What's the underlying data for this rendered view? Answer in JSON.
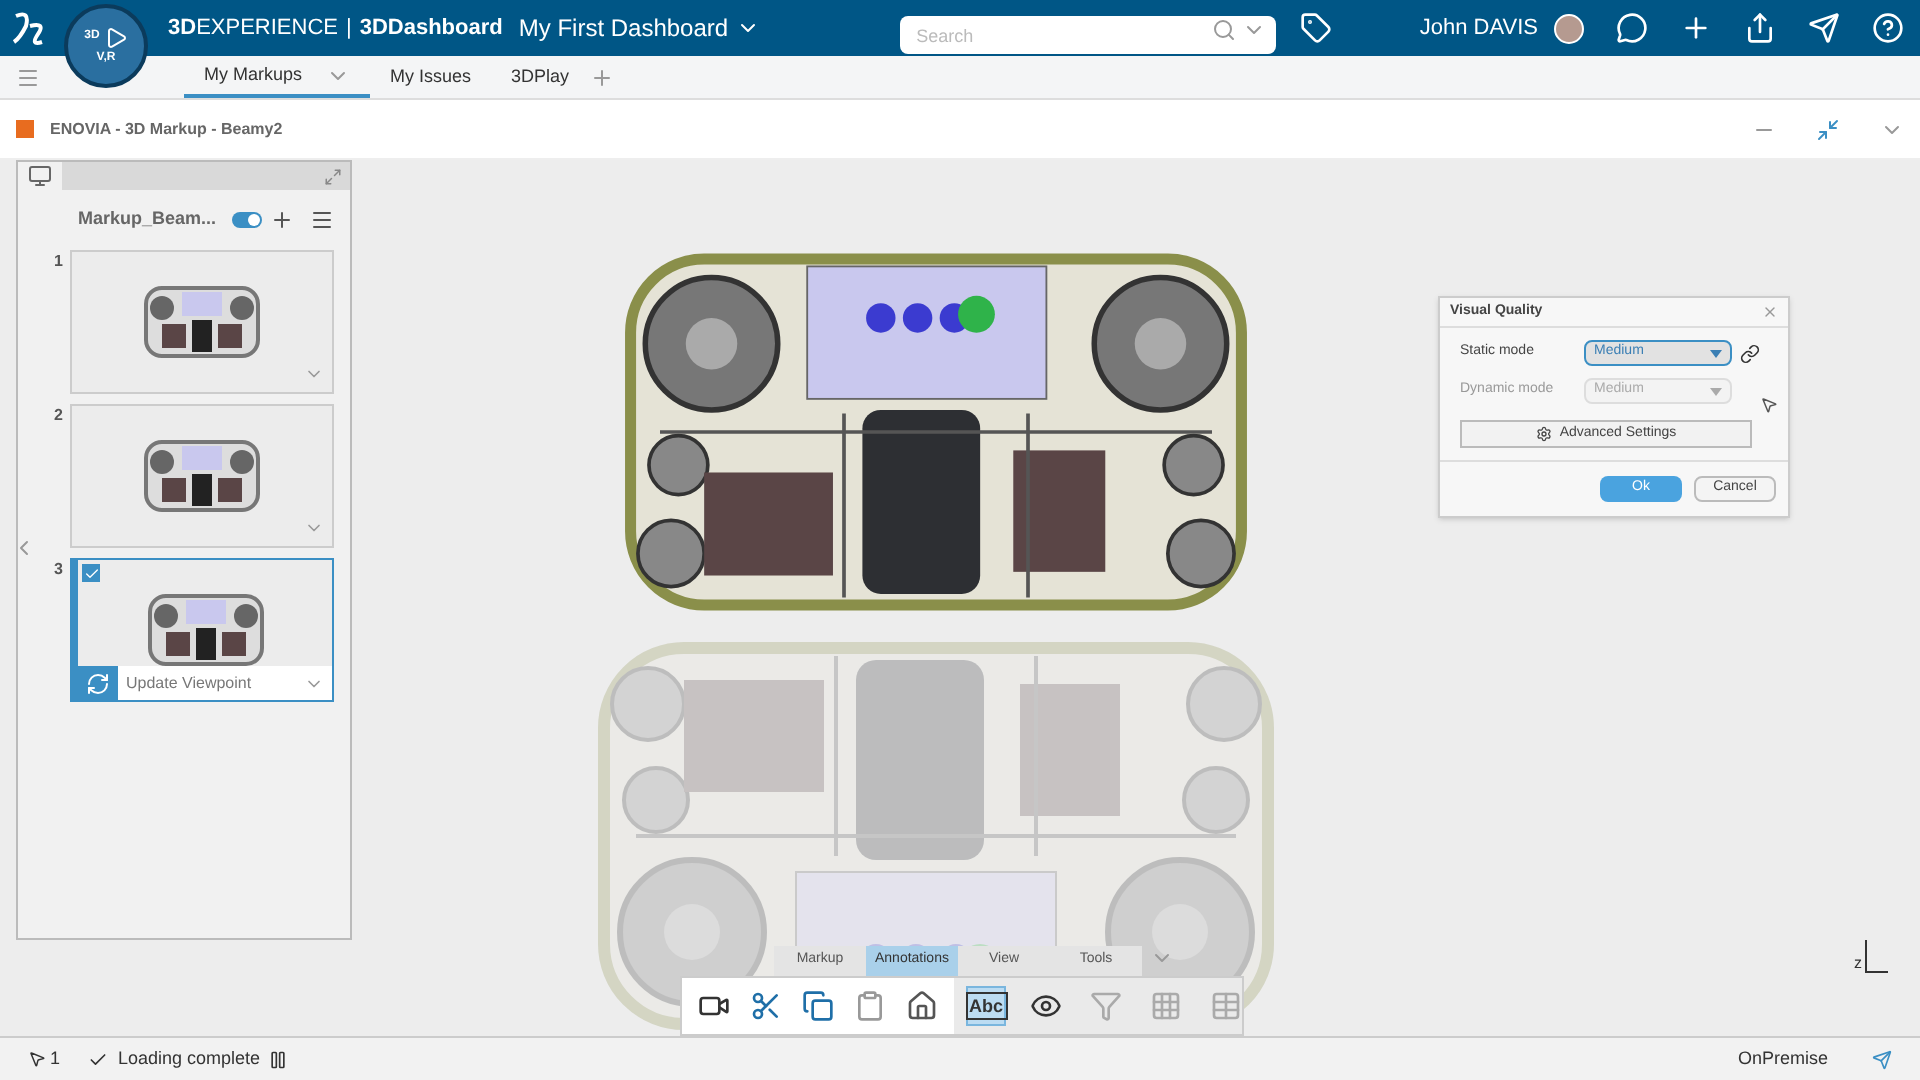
{
  "top_bar": {
    "brand": "3DEXPERIENCE",
    "separator": "|",
    "app": "3DDashboard",
    "dashboard": "My First Dashboard",
    "search": {
      "placeholder": "Search"
    },
    "user": "John DAVIS"
  },
  "compass": {
    "labels": [
      "3D",
      "V,R"
    ]
  },
  "tabs": [
    {
      "label": "My Markups",
      "selected": true,
      "has_menu": true
    },
    {
      "label": "My Issues",
      "selected": false,
      "has_menu": false
    },
    {
      "label": "3DPlay",
      "selected": false,
      "has_menu": false
    }
  ],
  "widget": {
    "title": "ENOVIA - 3D Markup - Beamy2"
  },
  "markup_panel": {
    "title": "Markup_Beam...",
    "toggle_on": true,
    "slides": [
      {
        "number": "1",
        "selected": false
      },
      {
        "number": "2",
        "selected": false
      },
      {
        "number": "3",
        "selected": true,
        "action": "Update Viewpoint"
      }
    ]
  },
  "dialog": {
    "title": "Visual Quality",
    "fields": [
      {
        "label": "Static mode",
        "value": "Medium",
        "disabled": false
      },
      {
        "label": "Dynamic mode",
        "value": "Medium",
        "disabled": true
      }
    ],
    "settings_button": "Advanced Settings",
    "buttons": [
      {
        "label": "Ok",
        "primary": true
      },
      {
        "label": "Cancel",
        "primary": false
      }
    ]
  },
  "toolbar": {
    "tabs": [
      {
        "label": "Markup",
        "selected": false
      },
      {
        "label": "Annotations",
        "selected": true
      },
      {
        "label": "View",
        "selected": false
      },
      {
        "label": "Tools",
        "selected": false
      }
    ],
    "tools": [
      {
        "kind": "text",
        "label": "Abc",
        "selected": true,
        "disabled": false
      },
      {
        "kind": "show",
        "selected": false,
        "disabled": false
      },
      {
        "kind": "filter",
        "selected": false,
        "disabled": true
      },
      {
        "kind": "grid",
        "selected": false,
        "disabled": true
      },
      {
        "kind": "table",
        "selected": false,
        "disabled": true
      }
    ]
  },
  "axis": {
    "label": "z"
  },
  "status_bar": {
    "selection_count": "1",
    "message": "Loading complete",
    "mode": "OnPremise"
  }
}
